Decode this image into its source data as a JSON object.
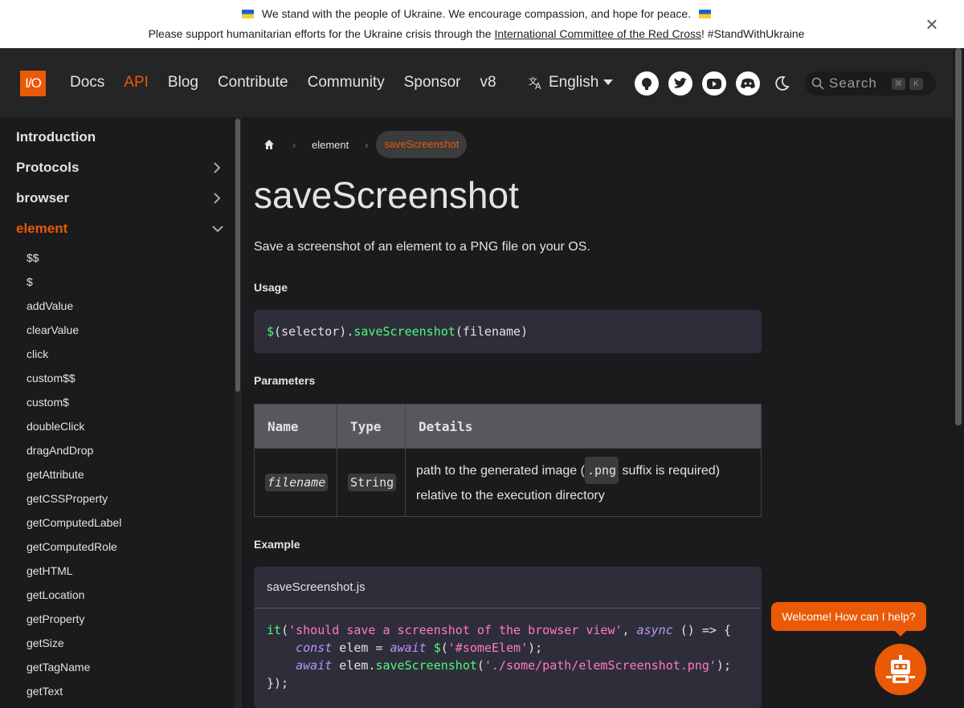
{
  "announcement": {
    "line1": "We stand with the people of Ukraine. We encourage compassion, and hope for peace.",
    "line2_prefix": "Please support humanitarian efforts for the Ukraine crisis through the",
    "line2_link": "International Committee of the Red Cross",
    "line2_suffix": "! #StandWithUkraine",
    "close_label": "×"
  },
  "navbar": {
    "logo_text": "I/O",
    "links": [
      "Docs",
      "API",
      "Blog",
      "Contribute",
      "Community",
      "Sponsor",
      "v8"
    ],
    "active_link": "API",
    "language": "English",
    "socials": [
      "github-icon",
      "twitter-icon",
      "youtube-icon",
      "discord-icon"
    ],
    "search_placeholder": "Search",
    "search_keys": [
      "⌘",
      "K"
    ]
  },
  "sidebar": {
    "categories": [
      {
        "label": "Introduction",
        "chevron": "none"
      },
      {
        "label": "Protocols",
        "chevron": "right"
      },
      {
        "label": "browser",
        "chevron": "right"
      },
      {
        "label": "element",
        "chevron": "down",
        "active": true
      }
    ],
    "items": [
      "$$",
      "$",
      "addValue",
      "clearValue",
      "click",
      "custom$$",
      "custom$",
      "doubleClick",
      "dragAndDrop",
      "getAttribute",
      "getCSSProperty",
      "getComputedLabel",
      "getComputedRole",
      "getHTML",
      "getLocation",
      "getProperty",
      "getSize",
      "getTagName",
      "getText"
    ]
  },
  "breadcrumb": {
    "home": "home-icon",
    "parent": "element",
    "current": "saveScreenshot"
  },
  "content": {
    "title": "saveScreenshot",
    "lead": "Save a screenshot of an element to a PNG file on your OS.",
    "usage_heading": "Usage",
    "usage_code": {
      "dollar": "$",
      "open": "(selector).",
      "method": "saveScreenshot",
      "args": "(filename)"
    },
    "parameters_heading": "Parameters",
    "table": {
      "headers": [
        "Name",
        "Type",
        "Details"
      ],
      "row": {
        "name": "filename",
        "type": "String",
        "details_prefix": "path to the generated image (",
        "details_code": ".png",
        "details_suffix": " suffix is required) relative to the execution directory"
      }
    },
    "example_heading": "Example",
    "example_filename": "saveScreenshot.js",
    "example_code": {
      "l1_it": "it",
      "l1_str": "'should save a screenshot of the browser view'",
      "l1_async": "async",
      "l1_rest": " () => {",
      "l2_const": "const",
      "l2_var": " elem = ",
      "l2_await": "await",
      "l2_dollar": "$",
      "l2_str": "'#someElem'",
      "l2_end": ");",
      "l3_await": "await",
      "l3_obj": " elem.",
      "l3_method": "saveScreenshot",
      "l3_str": "'./some/path/elemScreenshot.png'",
      "l3_end": ");",
      "l4": "});"
    }
  },
  "chat": {
    "welcome": "Welcome! How can I help?"
  },
  "colors": {
    "accent": "#ea5906",
    "background": "#1b1b1d",
    "navbar": "#242526",
    "code_bg": "#2e2e3a"
  }
}
